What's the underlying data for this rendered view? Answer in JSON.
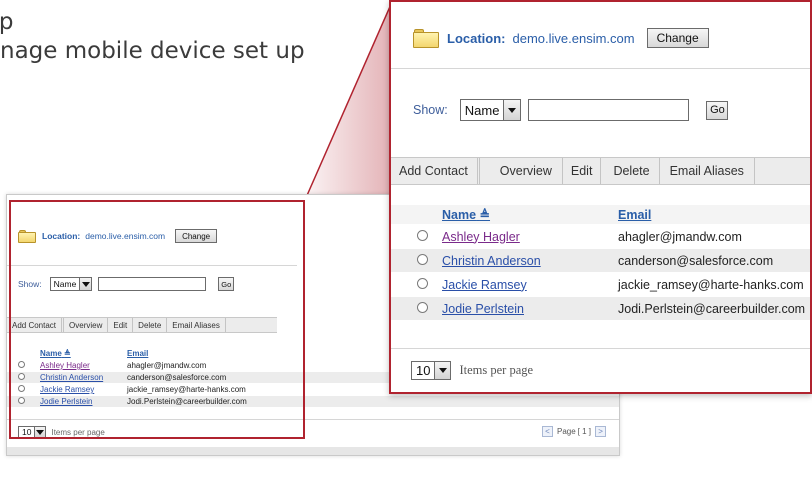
{
  "heading": {
    "line1": "g       g p",
    "line2": "nage mobile device set up"
  },
  "location": {
    "label": "Location:",
    "value": "demo.live.ensim.com",
    "change_label": "Change"
  },
  "filter": {
    "show_label": "Show:",
    "field_value": "Name",
    "search_value": "",
    "go_label": "Go"
  },
  "toolbar": {
    "items": [
      "Add Contact",
      "Overview",
      "Edit",
      "Delete",
      "Email Aliases"
    ]
  },
  "table": {
    "columns": {
      "name": "Name",
      "name_sort_glyph": "≜",
      "email": "Email"
    },
    "rows": [
      {
        "name": "Ashley Hagler",
        "email": "ahagler@jmandw.com",
        "selected": true
      },
      {
        "name": "Christin Anderson",
        "email": "canderson@salesforce.com",
        "selected": false
      },
      {
        "name": "Jackie Ramsey",
        "email": "jackie_ramsey@harte-hanks.com",
        "selected": false
      },
      {
        "name": "Jodie Perlstein",
        "email": "Jodi.Perlstein@careerbuilder.com",
        "selected": false
      }
    ]
  },
  "pagination": {
    "per_page_value": "10",
    "per_page_label": "Items per page",
    "page_label": "Page",
    "page_indicator": "[ 1 ]",
    "prev_glyph": "<",
    "next_glyph": ">"
  },
  "colors": {
    "accent_red": "#b0232f",
    "link_blue": "#2a5ea8",
    "visited_purple": "#7a2a8a"
  },
  "icons": [
    "folder-icon",
    "chevron-down-icon",
    "radio-selected-icon",
    "radio-unselected-icon",
    "sort-ascending-icon"
  ]
}
